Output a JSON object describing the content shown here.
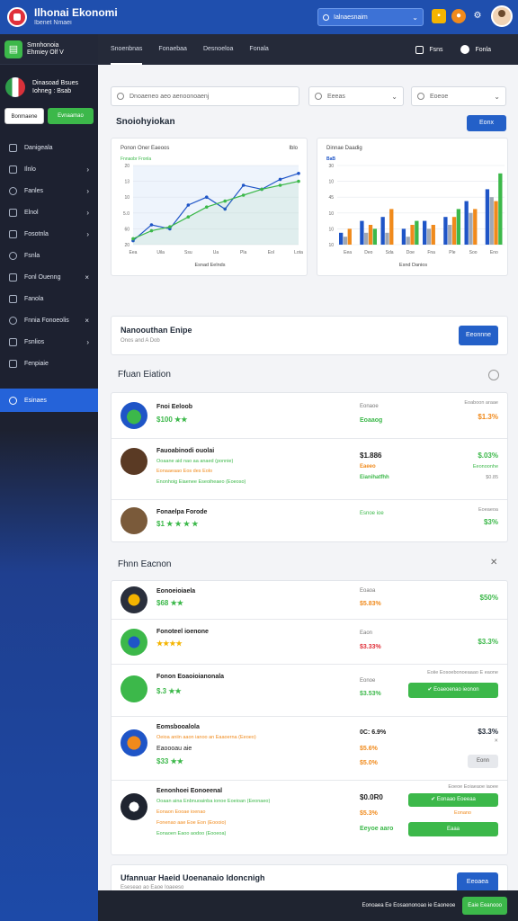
{
  "app": {
    "title": "Ilhonai Ekonomi",
    "subtitle": "Ibenet Nmaei"
  },
  "topbar": {
    "search_text": "Ialnaesnaim"
  },
  "sidebar": {
    "title": "Smnhonoia\nEhmiey Olf V",
    "org_line1": "Dinasoad Bsues",
    "org_line2": "Iohneg : Bsab",
    "btn_left": "Bonmaene",
    "btn_right": "Evnaamao",
    "items": [
      {
        "label": "Danigeala",
        "arrow": ""
      },
      {
        "label": "Ilnlo",
        "arrow": "›"
      },
      {
        "label": "Fanles",
        "arrow": "›"
      },
      {
        "label": "Elnol",
        "arrow": "›"
      },
      {
        "label": "Fosotnla",
        "arrow": "›"
      },
      {
        "label": "Fsnla",
        "arrow": ""
      },
      {
        "label": "Fonl Ouenng",
        "arrow": "×"
      },
      {
        "label": "Fanola",
        "arrow": ""
      },
      {
        "label": "Fnnia Fonoeolis",
        "arrow": "×"
      },
      {
        "label": "Fsnlios",
        "arrow": "›"
      },
      {
        "label": "Fenpiaie",
        "arrow": ""
      }
    ],
    "active_item": "Esinaes"
  },
  "tabs": {
    "items": [
      "Snoenbnas",
      "Fonaebaa",
      "Desnoeloa",
      "Fonala"
    ],
    "right_label": "Fsns",
    "right_label2": "Fonla"
  },
  "filters": {
    "search_placeholder": "Dnoaeneo aeo aenoonoaenj",
    "select1": "Eeeas",
    "select2": "Eoeoe"
  },
  "section1": {
    "title": "Snoiohyiokan",
    "button": "Eonx"
  },
  "chart_left": {
    "title": "Ponon Oner Eaeoos",
    "title_right": "Iblo",
    "legend": "Fnnaobr Fronla",
    "xlabel": "Esnad Eelnds"
  },
  "chart_right": {
    "title": "Dinnae Daadig",
    "legend": "BaB",
    "xlabel": "Esnd Danios"
  },
  "chart_data": [
    {
      "type": "line",
      "title": "Ponon Oner Eaeoos",
      "x": [
        "Eea",
        "Uila",
        "Ssu",
        "Ua",
        "Pla",
        "Eol",
        "Lota"
      ],
      "yticks": [
        "20",
        "13",
        "10",
        "5.0",
        "60",
        "20"
      ],
      "series": [
        {
          "values": [
            1.0,
            5.0,
            4.0,
            10.0,
            12.0,
            9.0,
            15.0,
            14.0,
            16.5,
            18.0
          ]
        },
        {
          "values": [
            1.5,
            3.5,
            4.5,
            7.0,
            9.5,
            11.0,
            12.5,
            14.0,
            15.0,
            16.0
          ]
        }
      ],
      "ylim": [
        0,
        20
      ],
      "grid": true
    },
    {
      "type": "bar",
      "title": "Dinnae Daadig",
      "categories": [
        "Eea",
        "Deo",
        "Sda",
        "Doe",
        "Fna",
        "Ple",
        "Soo",
        "Eno"
      ],
      "series": [
        {
          "values": [
            3,
            6,
            7,
            4,
            6,
            7,
            11,
            14
          ]
        },
        {
          "values": [
            2,
            3,
            3,
            2,
            4,
            5,
            8,
            12
          ]
        },
        {
          "values": [
            4,
            5,
            9,
            5,
            5,
            7,
            9,
            11
          ]
        },
        {
          "values": [
            0,
            4,
            0,
            6,
            0,
            9,
            0,
            18
          ]
        }
      ],
      "series_colors": [
        "#1f55c7",
        "#a0a8b5",
        "#f08a1c",
        "#3cb84a"
      ],
      "yticks": [
        "30",
        "10",
        "45",
        "10",
        "10",
        "10"
      ],
      "ylim": [
        0,
        20
      ]
    }
  ],
  "banner": {
    "title": "Nanoouthan Enipe",
    "subtitle": "Onos and A Dob",
    "button": "Eeonnne"
  },
  "section2": {
    "title": "Ffuan Eiation"
  },
  "list1": [
    {
      "name": "Fnoi Eeloob",
      "price": "$100",
      "stars": "★★",
      "mid_top": "Eonaoe",
      "mid_bottom": "Eoaaog",
      "right_top": "Eoaboon araae",
      "right_bottom": "$1.3%"
    },
    {
      "name": "Fauoabinodi ouolai",
      "price": "$1.8 ★★",
      "sub1": "Ooaane aid nao aa anaed (ponnie)",
      "sub2": "Eonaaeaao Eos des Eolo",
      "sub3": "Enonhoig Eiaenee Eseoiheaeo (Eoeoso)",
      "mid_value": "$1.886",
      "mid_sub1": "Eaeeo",
      "mid_sub2": "Eianihatfhh",
      "right_top": "$.03%",
      "right_sub1": "Eeonoonhe",
      "right_sub2": "$0.85"
    },
    {
      "name": "Fonaelpa Forode",
      "price": "$1 ★ ★ ★ ★",
      "mid_top": "Esnoe ioe",
      "right_top": "Eoeaeoa",
      "right_bottom": "$3%"
    }
  ],
  "section3": {
    "title": "Fhnn Eacnon"
  },
  "list2": [
    {
      "name": "Eonoeioiaela",
      "price": "$68",
      "mid_top": "Eoaoa",
      "mid_bottom": "$5.83%",
      "right": "$50%"
    },
    {
      "name": "Fonoteel ioenone",
      "price": "★★★★",
      "mid_top": "Eaon",
      "mid_bottom": "$3.33%",
      "right": "$3.3%"
    },
    {
      "name": "Fonon Eoaoioianonala",
      "price": "$.3 ★★",
      "mid_top": "Eonoe",
      "mid_bottom": "$3.53%",
      "right_top": "Eoiie Eosoebonoeaaao E eaone",
      "button": "Eoaeoenao ieonon"
    },
    {
      "name": "Eomsbooalola",
      "price": "$33 ★★",
      "sub1": "Oeioa aniin aaon ianoo an Eaaoerna (Eeoeo)",
      "sub2": "Eaoooau aie",
      "mid_top": "0C: 6.9%",
      "mid_sub1": "$5.6%",
      "mid_sub2": "$5.0%",
      "right_top": "$3.3%",
      "right_sub": "✕",
      "button": "Eonn"
    },
    {
      "name": "Eenonhoei Eonoeenal",
      "sub1": "Ooaan aina Enbnuoainba ionoe Eoeioan (Eeonaeo)",
      "sub2": "Eonaon Eooae ioenao",
      "sub3": "Fonenao aae Eoe Eon (Eoooio)",
      "sub4": "Eonaoen Eaoo aodoo (Eooeoa)",
      "mid_value": "$0.0R0",
      "mid_sub1": "$5.3%",
      "mid_sub2": "Eeyoe aaro",
      "right_top": "Eoeoe Eoiaeaoe iaoee",
      "button1": "Eonaao Eoeeaa",
      "mid_label": "Eonano",
      "button2": "Eaaa"
    }
  ],
  "bottom_banner": {
    "title": "Ufannuar Haeid Uoenanaio Idoncnigh",
    "subtitle": "Eseseao ao Eaoe Ioaeeso",
    "button": "Eeoaea"
  },
  "footer": {
    "text": "Eonoaea Ee Eosaononoao ie Eaoneoe",
    "button": "Eaie Eeanooo"
  }
}
